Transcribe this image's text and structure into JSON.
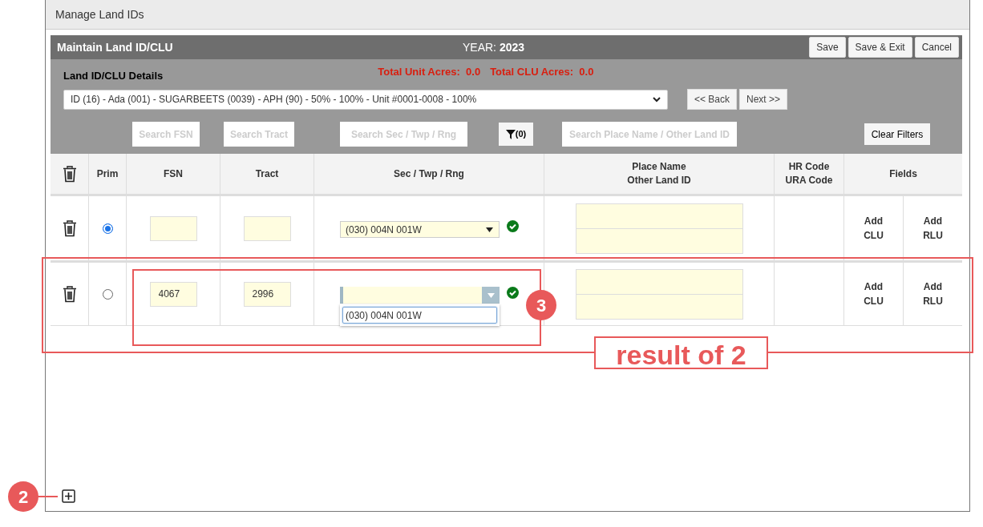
{
  "dialog": {
    "title": "Manage Land IDs"
  },
  "header": {
    "title": "Maintain Land ID/CLU",
    "year_label": "YEAR:",
    "year": "2023",
    "buttons": [
      "Save",
      "Save & Exit",
      "Cancel"
    ]
  },
  "details": {
    "title": "Land ID/CLU Details",
    "totals": [
      {
        "label": "Total Unit Acres:",
        "value": "0.0"
      },
      {
        "label": "Total CLU Acres:",
        "value": "0.0"
      }
    ],
    "unit_select": "ID (16) - Ada (001) - SUGARBEETS (0039) - APH (90) - 50% - 100% - Unit #0001-0008 - 100%",
    "nav_buttons": [
      "<< Back",
      "Next >>"
    ]
  },
  "filters": {
    "fsn": {
      "placeholder": "Search FSN"
    },
    "tract": {
      "placeholder": "Search Tract"
    },
    "sec": {
      "placeholder": "Search Sec / Twp / Rng"
    },
    "filter_button": "(0)",
    "place": {
      "placeholder": "Search Place Name / Other Land ID"
    },
    "clear_button": "Clear Filters"
  },
  "table": {
    "columns": [
      "Prim",
      "FSN",
      "Tract",
      "Sec / Twp / Rng",
      "Place Name\nOther Land ID",
      "HR Code\nURA Code",
      "Fields"
    ],
    "rows": [
      {
        "selected": true,
        "sec": "(030) 004N 001W",
        "expanded": false,
        "valid": true,
        "field_buttons": [
          "Add\nCLU",
          "Add\nRLU"
        ]
      },
      {
        "selected": false,
        "fsn": "4067",
        "tract": "2996",
        "expanded": true,
        "options": [
          "(030) 004N 001W"
        ],
        "valid": true,
        "field_buttons": [
          "Add\nCLU",
          "Add\nRLU"
        ]
      }
    ]
  },
  "annotations": [
    {
      "kind": "badge",
      "text": "2"
    },
    {
      "kind": "badge",
      "text": "3"
    },
    {
      "kind": "caption",
      "text": "result of 2"
    }
  ]
}
